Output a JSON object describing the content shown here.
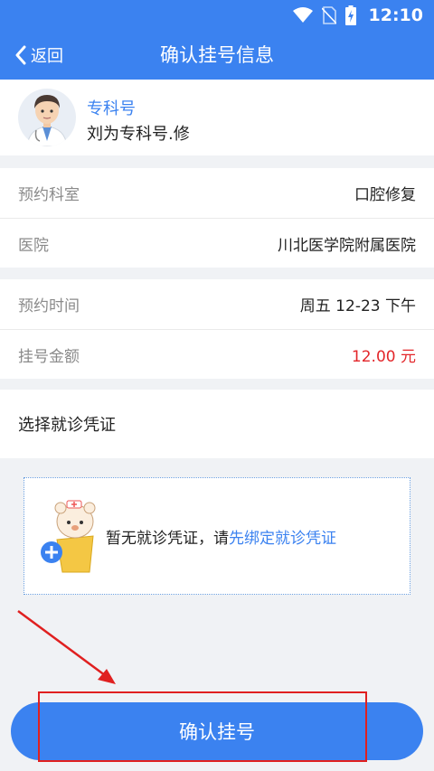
{
  "status_bar": {
    "time": "12:10",
    "icons": [
      "wifi-icon",
      "no-sim-icon",
      "battery-charging-icon"
    ]
  },
  "navbar": {
    "back_label": "返回",
    "title": "确认挂号信息"
  },
  "doctor": {
    "type": "专科号",
    "name": "刘为专科号.修",
    "avatar": "doctor-avatar"
  },
  "appointment": {
    "department_label": "预约科室",
    "department_value": "口腔修复",
    "hospital_label": "医院",
    "hospital_value": "川北医学院附属医院",
    "time_label": "预约时间",
    "time_value": "周五 12-23 下午",
    "fee_label": "挂号金额",
    "fee_value": "12.00 元"
  },
  "credential": {
    "section_title": "选择就诊凭证",
    "empty_text": "暂无就诊凭证，请",
    "link_text": "先绑定就诊凭证"
  },
  "confirm_button": "确认挂号",
  "colors": {
    "primary": "#3b82f0",
    "price": "#e3262a",
    "annotation": "#e02020"
  }
}
